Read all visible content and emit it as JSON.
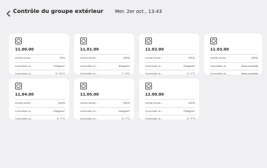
{
  "header": {
    "title": "Contrôle du groupe extérieur",
    "datetime": "Mer. 2er oct., 13:43"
  },
  "cards": [
    {
      "name": "11.00.00",
      "rows": [
        {
          "label": "Limite actue...",
          "value": "75%"
        },
        {
          "label": "Correction d...",
          "value": "27kg/cm²"
        },
        {
          "label": "Correction d...",
          "value": "9~11°C"
        }
      ]
    },
    {
      "name": "11.01.00",
      "rows": [
        {
          "label": "Limite actue...",
          "value": "100%"
        },
        {
          "label": "Correction d...",
          "value": "30kg/cm²"
        },
        {
          "label": "Correction d...",
          "value": "7~9°C"
        }
      ]
    },
    {
      "name": "11.02.00",
      "rows": [
        {
          "label": "Limite actue...",
          "value": "100%"
        },
        {
          "label": "Correction d...",
          "value": "23kg/cm²"
        },
        {
          "label": "Correction d...",
          "value": "5~7°C"
        }
      ]
    },
    {
      "name": "11.03.00",
      "rows": [
        {
          "label": "Limite actue...",
          "value": "100%"
        },
        {
          "label": "Correction d...",
          "value": "Auto-contrôle"
        },
        {
          "label": "Correction d...",
          "value": "Auto-contrôle"
        }
      ]
    },
    {
      "name": "11.04.00",
      "rows": [
        {
          "label": "Limite actue...",
          "value": "100%"
        },
        {
          "label": "Correction d...",
          "value": "23kg/cm²"
        },
        {
          "label": "Correction d...",
          "value": "5~7°C"
        }
      ]
    },
    {
      "name": "11.05.00",
      "rows": [
        {
          "label": "Limite actue...",
          "value": "100%"
        },
        {
          "label": "Correction d...",
          "value": "23kg/cm²"
        },
        {
          "label": "Correction d...",
          "value": "5~7°C"
        }
      ]
    },
    {
      "name": "12.00.00",
      "rows": [
        {
          "label": "Limite actue...",
          "value": "100%"
        },
        {
          "label": "Correction d...",
          "value": "23kg/cm²"
        },
        {
          "label": "Correction d...",
          "value": "5~7°C"
        }
      ]
    }
  ]
}
